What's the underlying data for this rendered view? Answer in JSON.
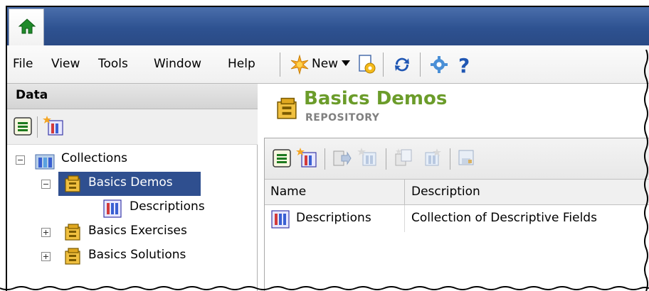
{
  "menu": {
    "items": [
      "File",
      "View",
      "Tools",
      "Window",
      "Help"
    ],
    "new_label": "New"
  },
  "left_pane": {
    "title": "Data",
    "tree": [
      {
        "label": "Collections",
        "expander": "minus"
      },
      {
        "label": "Basics Demos",
        "expander": "minus",
        "selected": true
      },
      {
        "label": "Descriptions",
        "expander": "none"
      },
      {
        "label": "Basics Exercises",
        "expander": "plus"
      },
      {
        "label": "Basics Solutions",
        "expander": "plus"
      }
    ]
  },
  "right_pane": {
    "title": "Basics Demos",
    "subtitle": "REPOSITORY",
    "columns": [
      "Name",
      "Description"
    ],
    "rows": [
      {
        "name": "Descriptions",
        "description": "Collection of Descriptive Fields"
      }
    ]
  },
  "colors": {
    "title_bar": "#2e5291",
    "selection": "#2f4f8f",
    "title_green": "#6b9c2a"
  }
}
